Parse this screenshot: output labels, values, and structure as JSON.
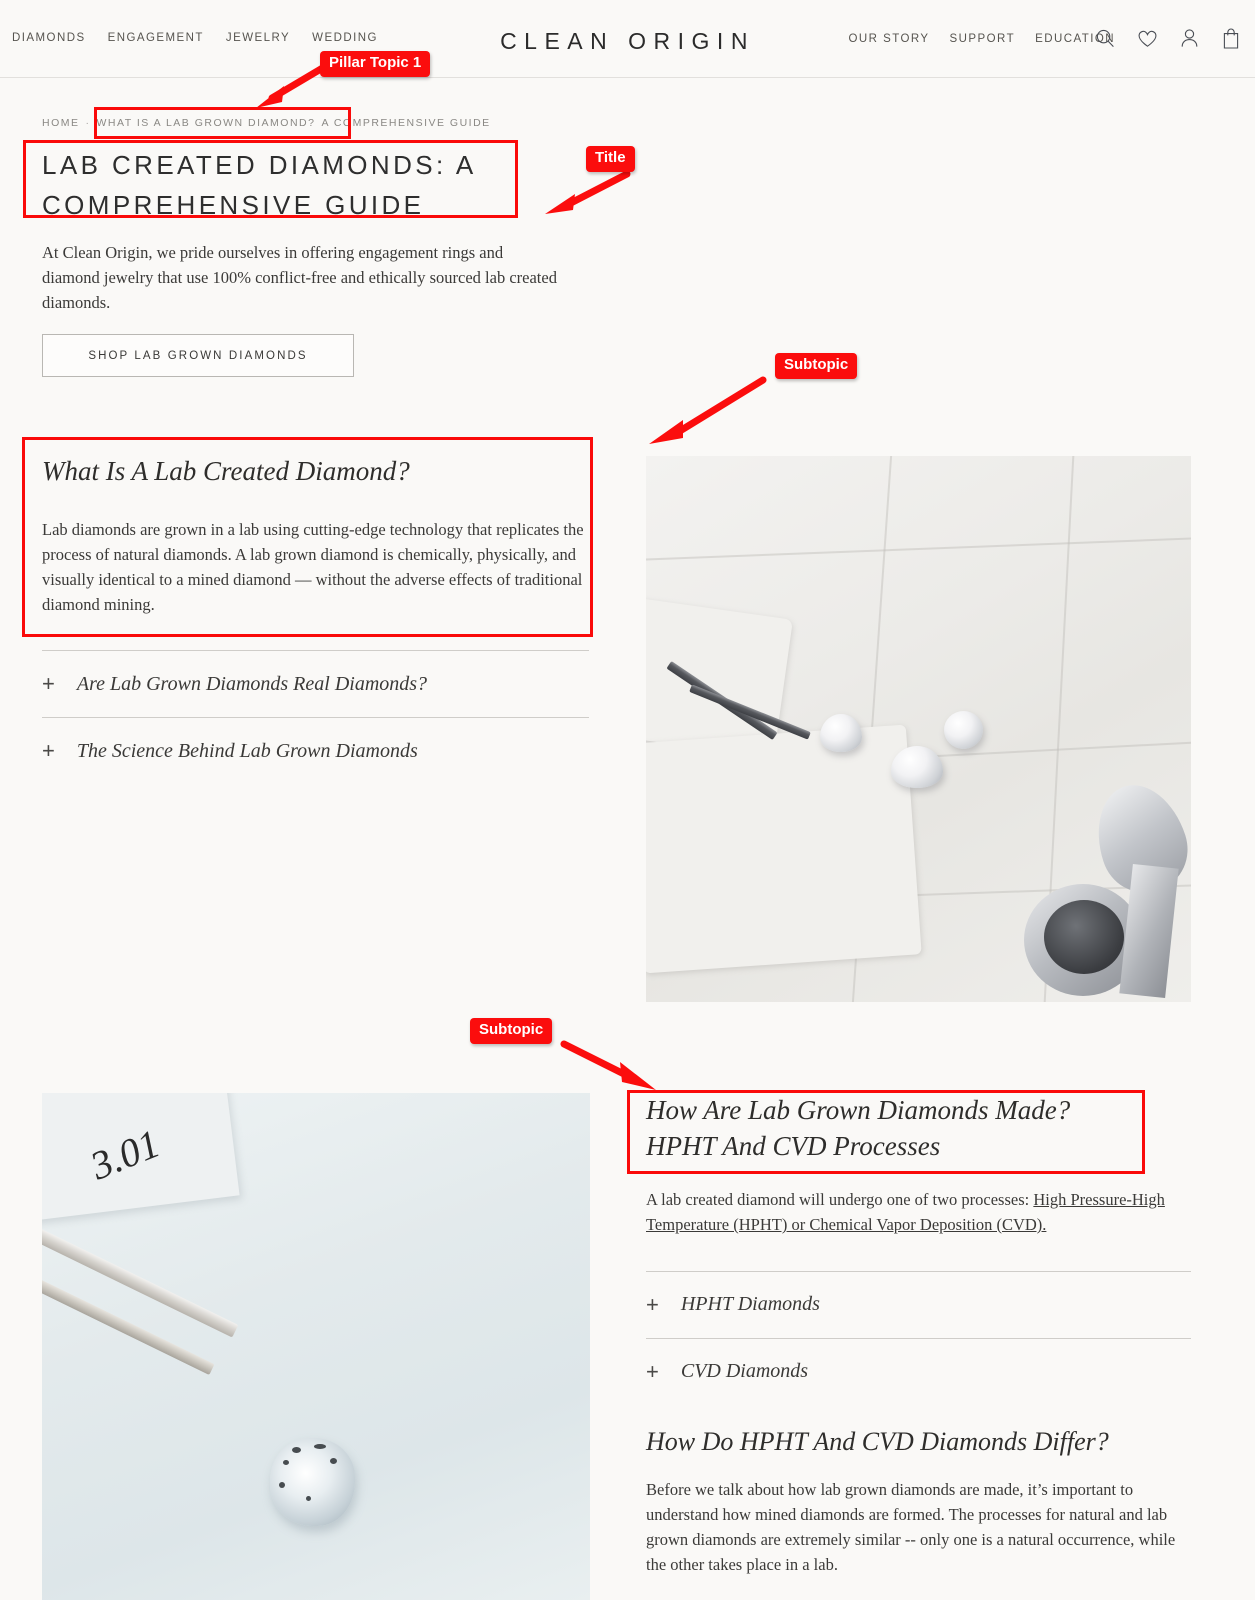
{
  "header": {
    "brand": "CLEAN ORIGIN",
    "nav_left": [
      {
        "label": "DIAMONDS"
      },
      {
        "label": "ENGAGEMENT"
      },
      {
        "label": "JEWELRY"
      },
      {
        "label": "WEDDING"
      }
    ],
    "nav_right": [
      {
        "label": "OUR STORY"
      },
      {
        "label": "SUPPORT"
      },
      {
        "label": "EDUCATION"
      }
    ],
    "icons": [
      {
        "name": "search-icon"
      },
      {
        "name": "heart-icon"
      },
      {
        "name": "account-icon"
      },
      {
        "name": "shopping-bag-icon"
      }
    ]
  },
  "breadcrumb": {
    "home": "HOME",
    "separator": "·",
    "current": "WHAT IS A LAB GROWN DIAMOND?",
    "trailing": "A COMPREHENSIVE GUIDE"
  },
  "hero": {
    "title": "LAB CREATED DIAMONDS: A COMPREHENSIVE GUIDE",
    "intro": "At Clean Origin, we pride ourselves in offering engagement rings and diamond jewelry that use 100% conflict-free and ethically sourced lab created diamonds.",
    "cta_label": "SHOP LAB GROWN DIAMONDS"
  },
  "section_one": {
    "heading": "What Is A Lab Created Diamond?",
    "body": "Lab diamonds are grown in a lab using cutting-edge technology that replicates the process of natural diamonds. A lab grown diamond is chemically, physically, and visually identical to a mined diamond — without the adverse effects of traditional diamond mining.",
    "accordion": [
      {
        "plus": "+",
        "label": "Are Lab Grown Diamonds Real Diamonds?"
      },
      {
        "plus": "+",
        "label": "The Science Behind Lab Grown Diamonds"
      }
    ]
  },
  "section_two": {
    "heading_line1": "How Are Lab Grown Diamonds Made?",
    "heading_line2": "HPHT And CVD Processes",
    "intro_lead": "A lab created diamond will undergo one of two processes: ",
    "intro_link": "High Pressure-High Temperature (HPHT) or Chemical Vapor Deposition (CVD).",
    "accordion": [
      {
        "plus": "+",
        "label": "HPHT Diamonds"
      },
      {
        "plus": "+",
        "label": "CVD Diamonds"
      }
    ],
    "subheading": "How Do HPHT And CVD Diamonds Differ?",
    "body": "Before we talk about how lab grown diamonds are made, it’s important to understand how mined diamonds are formed. The processes for natural and lab grown diamonds are extremely similar -- only one is a natural occurrence, while the other takes place in a lab."
  },
  "images": {
    "top_right_alt": "Loose lab grown diamonds on white tile with tweezers, polishing cloth and jeweler's loupe",
    "bottom_left_alt": "Rough uncut diamond on a light blue surface next to tweezers and a handwritten 3.01 carat card",
    "handwritten_note": "3.01"
  },
  "annotations": {
    "accent_color": "#FB0D0D",
    "labels": [
      {
        "id": "pillar-topic-1",
        "text": "Pillar Topic 1"
      },
      {
        "id": "title",
        "text": "Title"
      },
      {
        "id": "subtopic-1",
        "text": "Subtopic"
      },
      {
        "id": "subtopic-2",
        "text": "Subtopic"
      }
    ]
  }
}
